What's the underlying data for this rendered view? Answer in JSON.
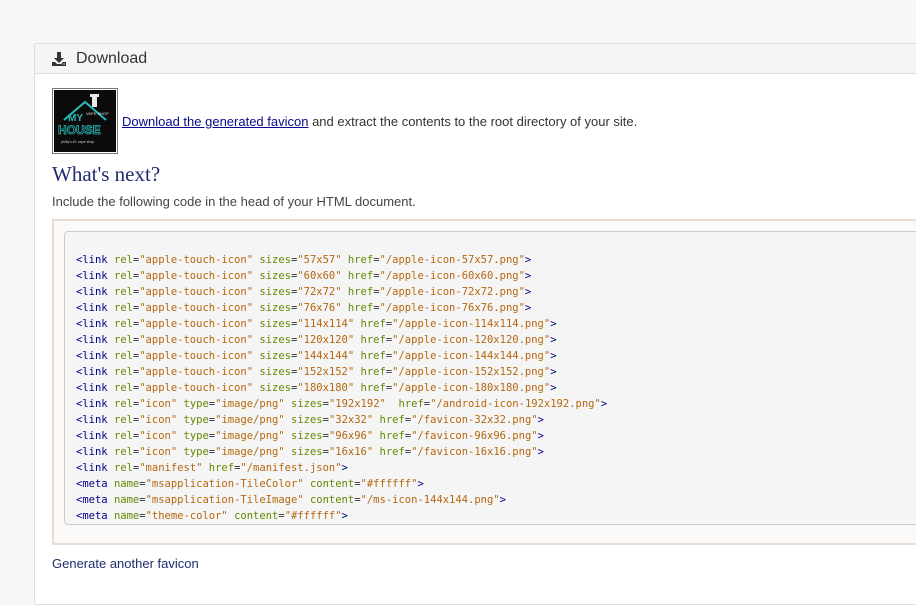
{
  "panel": {
    "title": "Download",
    "icon": "download-icon"
  },
  "intro": {
    "link_text": "Download the generated favicon",
    "rest_text": " and extract the contents to the root directory of your site."
  },
  "thumbnail": {
    "logo_lines": [
      "MY",
      "HOUSE",
      "VAPE SHOP"
    ],
    "caption": "philly's #1 vape shop"
  },
  "next": {
    "heading": "What's next?",
    "instruction": "Include the following code in the head of your HTML document."
  },
  "code_lines": [
    {
      "tag": "link",
      "attrs": [
        [
          "rel",
          "apple-touch-icon"
        ],
        [
          "sizes",
          "57x57"
        ],
        [
          "href",
          "/apple-icon-57x57.png"
        ]
      ]
    },
    {
      "tag": "link",
      "attrs": [
        [
          "rel",
          "apple-touch-icon"
        ],
        [
          "sizes",
          "60x60"
        ],
        [
          "href",
          "/apple-icon-60x60.png"
        ]
      ]
    },
    {
      "tag": "link",
      "attrs": [
        [
          "rel",
          "apple-touch-icon"
        ],
        [
          "sizes",
          "72x72"
        ],
        [
          "href",
          "/apple-icon-72x72.png"
        ]
      ]
    },
    {
      "tag": "link",
      "attrs": [
        [
          "rel",
          "apple-touch-icon"
        ],
        [
          "sizes",
          "76x76"
        ],
        [
          "href",
          "/apple-icon-76x76.png"
        ]
      ]
    },
    {
      "tag": "link",
      "attrs": [
        [
          "rel",
          "apple-touch-icon"
        ],
        [
          "sizes",
          "114x114"
        ],
        [
          "href",
          "/apple-icon-114x114.png"
        ]
      ]
    },
    {
      "tag": "link",
      "attrs": [
        [
          "rel",
          "apple-touch-icon"
        ],
        [
          "sizes",
          "120x120"
        ],
        [
          "href",
          "/apple-icon-120x120.png"
        ]
      ]
    },
    {
      "tag": "link",
      "attrs": [
        [
          "rel",
          "apple-touch-icon"
        ],
        [
          "sizes",
          "144x144"
        ],
        [
          "href",
          "/apple-icon-144x144.png"
        ]
      ]
    },
    {
      "tag": "link",
      "attrs": [
        [
          "rel",
          "apple-touch-icon"
        ],
        [
          "sizes",
          "152x152"
        ],
        [
          "href",
          "/apple-icon-152x152.png"
        ]
      ]
    },
    {
      "tag": "link",
      "attrs": [
        [
          "rel",
          "apple-touch-icon"
        ],
        [
          "sizes",
          "180x180"
        ],
        [
          "href",
          "/apple-icon-180x180.png"
        ]
      ]
    },
    {
      "tag": "link",
      "attrs": [
        [
          "rel",
          "icon"
        ],
        [
          "type",
          "image/png"
        ],
        [
          "sizes",
          "192x192"
        ],
        [
          "href",
          "/android-icon-192x192.png"
        ]
      ],
      "gap_before_last": true
    },
    {
      "tag": "link",
      "attrs": [
        [
          "rel",
          "icon"
        ],
        [
          "type",
          "image/png"
        ],
        [
          "sizes",
          "32x32"
        ],
        [
          "href",
          "/favicon-32x32.png"
        ]
      ]
    },
    {
      "tag": "link",
      "attrs": [
        [
          "rel",
          "icon"
        ],
        [
          "type",
          "image/png"
        ],
        [
          "sizes",
          "96x96"
        ],
        [
          "href",
          "/favicon-96x96.png"
        ]
      ]
    },
    {
      "tag": "link",
      "attrs": [
        [
          "rel",
          "icon"
        ],
        [
          "type",
          "image/png"
        ],
        [
          "sizes",
          "16x16"
        ],
        [
          "href",
          "/favicon-16x16.png"
        ]
      ]
    },
    {
      "tag": "link",
      "attrs": [
        [
          "rel",
          "manifest"
        ],
        [
          "href",
          "/manifest.json"
        ]
      ]
    },
    {
      "tag": "meta",
      "attrs": [
        [
          "name",
          "msapplication-TileColor"
        ],
        [
          "content",
          "#ffffff"
        ]
      ]
    },
    {
      "tag": "meta",
      "attrs": [
        [
          "name",
          "msapplication-TileImage"
        ],
        [
          "content",
          "/ms-icon-144x144.png"
        ]
      ]
    },
    {
      "tag": "meta",
      "attrs": [
        [
          "name",
          "theme-color"
        ],
        [
          "content",
          "#ffffff"
        ]
      ]
    }
  ],
  "footer": {
    "link_text": "Generate another favicon"
  },
  "colors": {
    "tag": "#000088",
    "attr_name": "#668800",
    "attr_value": "#b5670f",
    "heading": "#1f2d6e"
  }
}
